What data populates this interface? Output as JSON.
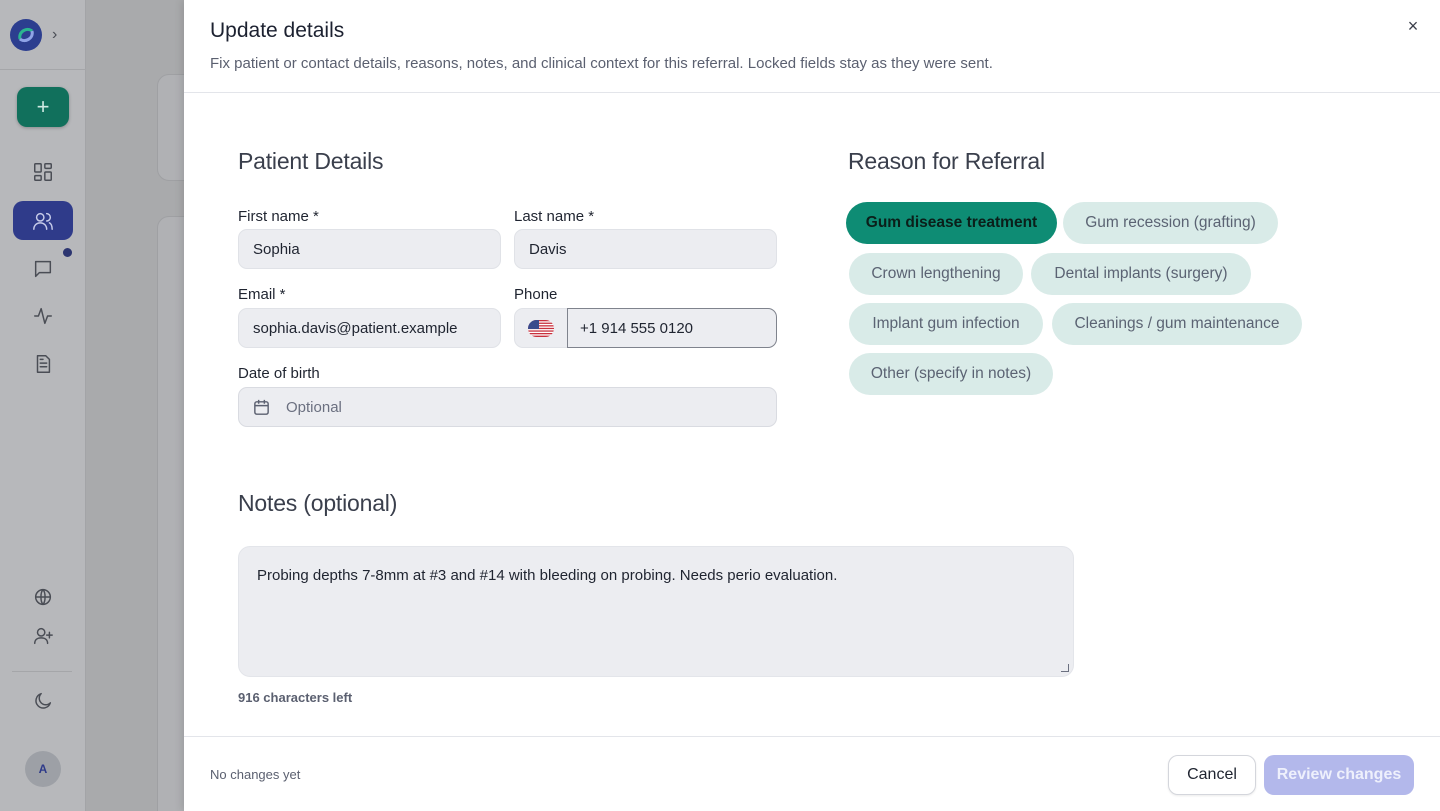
{
  "app": {
    "avatar_initial": "A"
  },
  "modal": {
    "title": "Update details",
    "subtitle": "Fix patient or contact details, reasons, notes, and clinical context for this referral. Locked fields stay as they were sent.",
    "close_label": "×"
  },
  "patient_details": {
    "section_title": "Patient Details",
    "first_name": {
      "label": "First name *",
      "value": "Sophia"
    },
    "last_name": {
      "label": "Last name *",
      "value": "Davis"
    },
    "email": {
      "label": "Email *",
      "value": "sophia.davis@patient.example"
    },
    "phone": {
      "label": "Phone",
      "value": "+1 914 555 0120",
      "country": "US"
    },
    "dob": {
      "label": "Date of birth",
      "placeholder": "Optional"
    }
  },
  "reason": {
    "section_title": "Reason for Referral",
    "chips": [
      {
        "label": "Gum disease treatment",
        "selected": true
      },
      {
        "label": "Gum recession (grafting)",
        "selected": false
      },
      {
        "label": "Crown lengthening",
        "selected": false
      },
      {
        "label": "Dental implants (surgery)",
        "selected": false
      },
      {
        "label": "Implant gum infection",
        "selected": false
      },
      {
        "label": "Cleanings / gum maintenance",
        "selected": false
      },
      {
        "label": "Other (specify in notes)",
        "selected": false
      }
    ]
  },
  "notes": {
    "section_title": "Notes (optional)",
    "value": "Probing depths 7-8mm at #3 and #14 with bleeding on probing. Needs perio evaluation.",
    "chars_left": "916 characters left"
  },
  "footer": {
    "status": "No changes yet",
    "cancel_label": "Cancel",
    "review_label": "Review changes"
  },
  "colors": {
    "accent": "#0e8c74",
    "chip_bg": "#d9ebe8",
    "primary_disabled": "#b3b8eb",
    "nav_active": "#2f3b8a"
  }
}
